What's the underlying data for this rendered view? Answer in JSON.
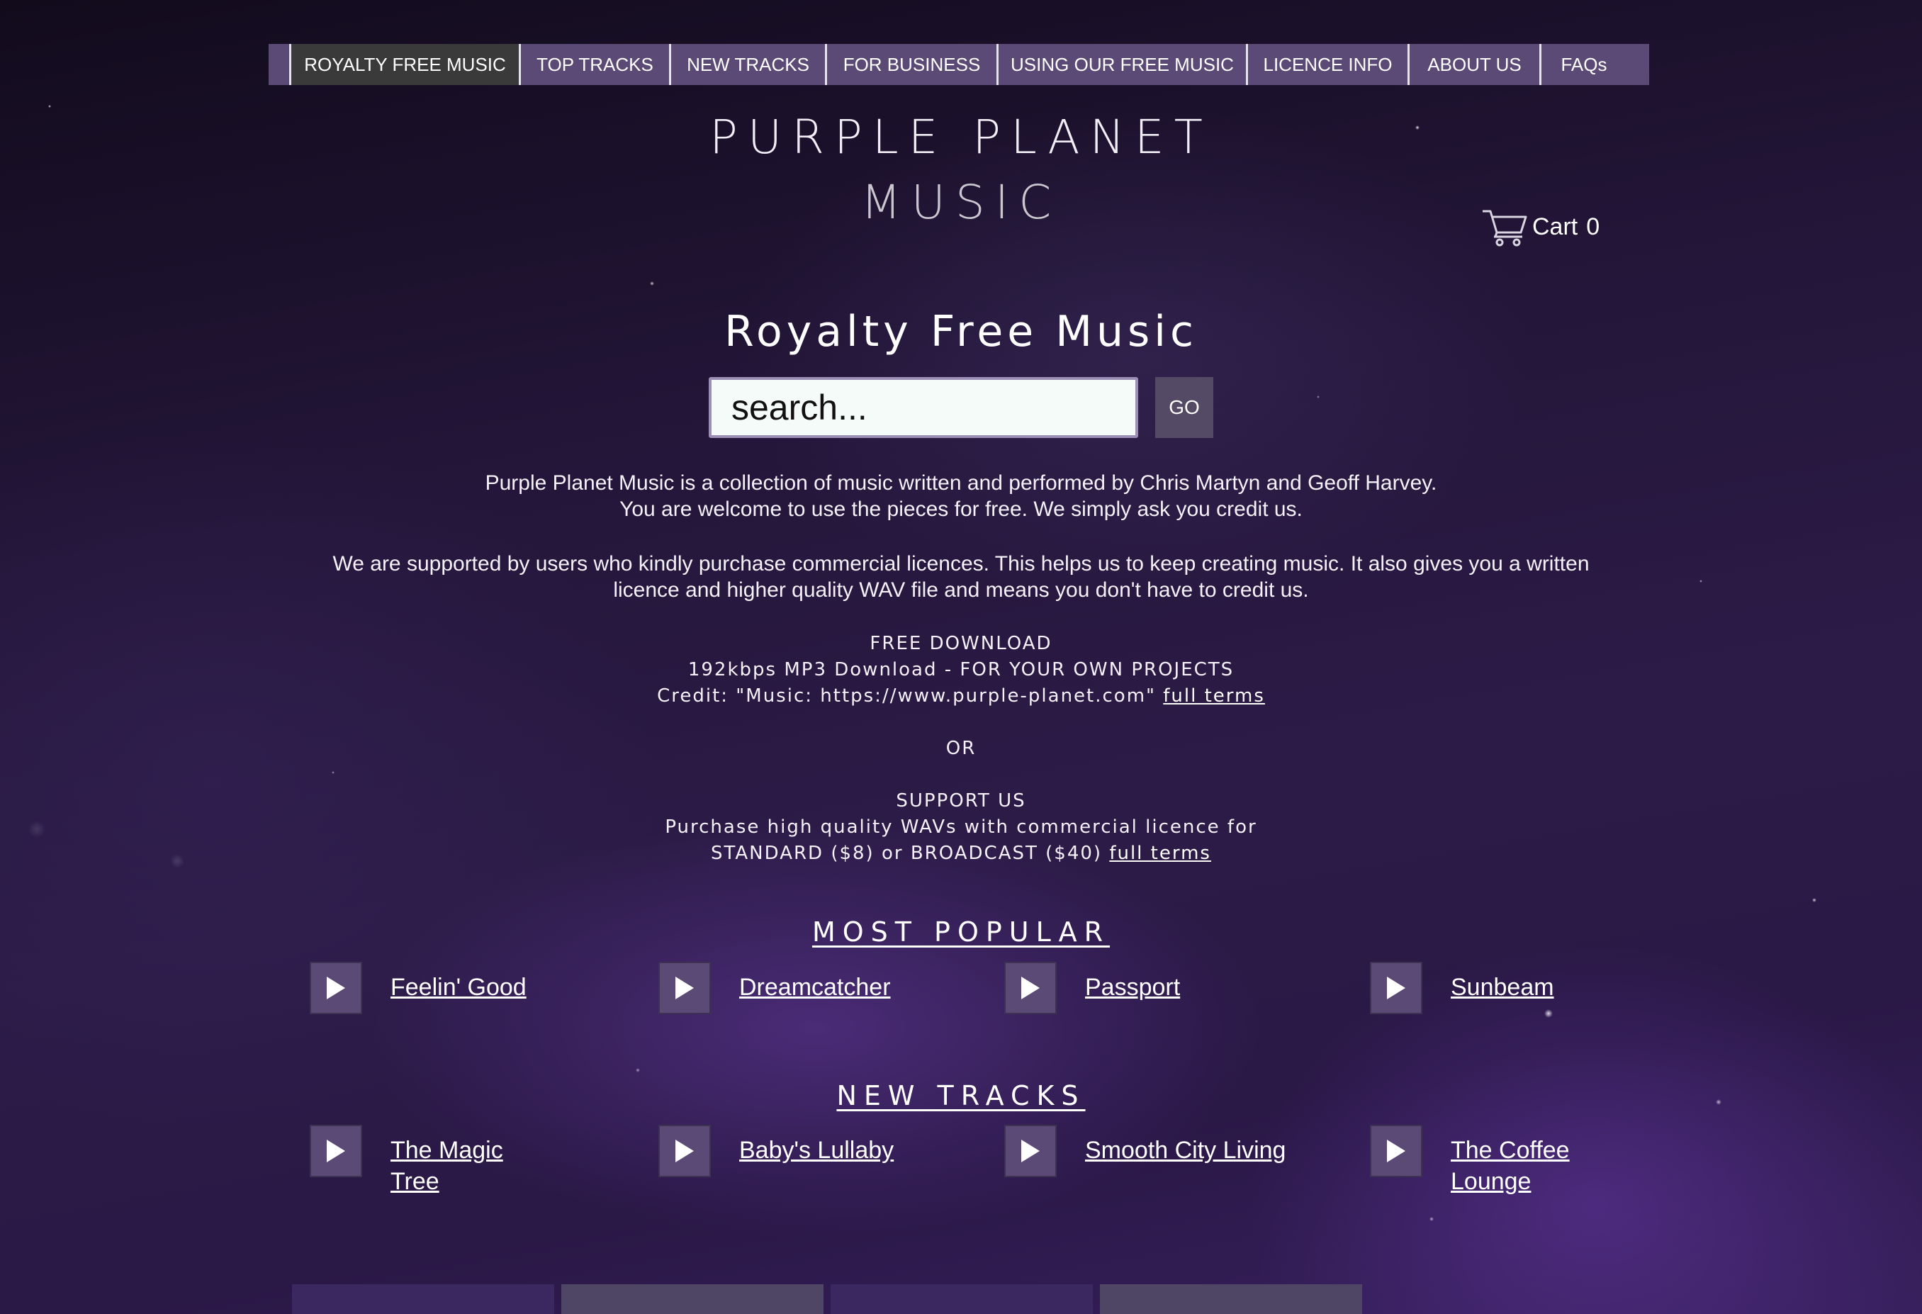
{
  "nav": {
    "items": [
      "ROYALTY FREE MUSIC",
      "TOP TRACKS",
      "NEW TRACKS",
      "FOR BUSINESS",
      "USING OUR FREE MUSIC",
      "LICENCE INFO",
      "ABOUT US",
      "FAQs"
    ],
    "active_index": 0
  },
  "header": {
    "title_line1": "PURPLE PLANET",
    "title_line2": "MUSIC"
  },
  "cart": {
    "label": "Cart",
    "count": "0",
    "icon": "cart-icon"
  },
  "main": {
    "heading": "Royalty Free Music",
    "search": {
      "placeholder": "search...",
      "button_label": "GO"
    },
    "intro": {
      "line1": "Purple Planet Music is a collection of music written and performed by Chris Martyn and Geoff Harvey.",
      "line2": "You are welcome to use the pieces for free. We simply ask you credit us.",
      "line3": "We are supported by users who kindly purchase commercial licences. This helps us to keep creating music. It also gives you a written",
      "line4": "licence and higher quality WAV file and means you don't have to credit us."
    },
    "free_download": {
      "heading": "FREE DOWNLOAD",
      "line1": "192kbps MP3 Download - FOR YOUR OWN PROJECTS",
      "line2": "Credit: \"Music: https://www.purple-planet.com\"",
      "link": "full terms"
    },
    "or_label": "OR",
    "support": {
      "heading": "SUPPORT US",
      "line1": "Purchase high quality WAVs with commercial licence for",
      "line2": "STANDARD ($8) or BROADCAST ($40)",
      "link": "full terms"
    }
  },
  "most_popular": {
    "heading": "MOST POPULAR",
    "tracks": [
      "Feelin' Good",
      "Dreamcatcher",
      "Passport",
      "Sunbeam"
    ]
  },
  "new_tracks": {
    "heading": "NEW TRACKS",
    "tracks": [
      "The Magic Tree",
      "Baby's Lullaby",
      "Smooth City Living",
      "The Coffee Lounge"
    ]
  },
  "colors": {
    "nav_bg": "#5a4a75",
    "nav_active": "#3a3a3a",
    "play_button": "#5a4a75",
    "background": "#1e1330"
  },
  "icons": {
    "play": "play-icon",
    "cart": "cart-icon"
  }
}
